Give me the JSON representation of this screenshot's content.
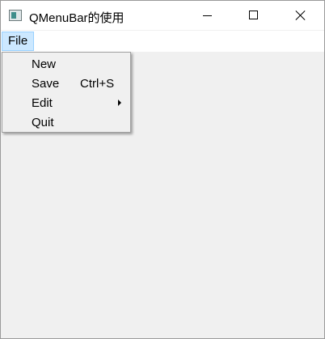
{
  "window": {
    "title": "QMenuBar的使用"
  },
  "menubar": {
    "file_label": "File"
  },
  "file_menu": {
    "items": [
      {
        "label": "New",
        "shortcut": ""
      },
      {
        "label": "Save",
        "shortcut": "Ctrl+S"
      },
      {
        "label": "Edit",
        "shortcut": "",
        "submenu": true
      },
      {
        "label": "Quit",
        "shortcut": ""
      }
    ]
  },
  "icons": {
    "app": "app-window-icon",
    "minimize": "minimize-icon",
    "maximize": "maximize-icon",
    "close": "close-icon",
    "submenu": "submenu-arrow-icon"
  },
  "colors": {
    "menu_highlight": "#cce8ff",
    "menu_highlight_border": "#99d1ff",
    "client_background": "#f0f0f0"
  }
}
